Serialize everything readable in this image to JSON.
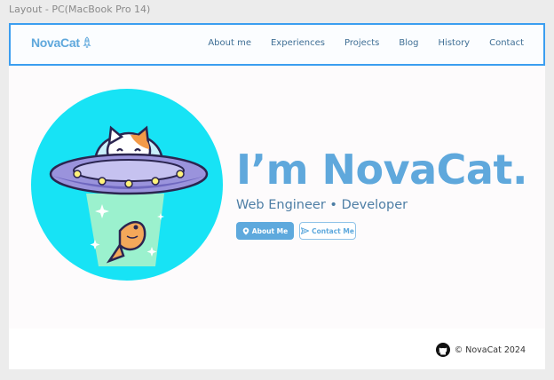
{
  "frame_label": "Layout - PC(MacBook Pro 14)",
  "header": {
    "brand": "NovaCat",
    "nav": [
      "About me",
      "Experiences",
      "Projects",
      "Blog",
      "History",
      "Contact"
    ]
  },
  "hero": {
    "title": "I’m NovaCat.",
    "subtitle": "Web Engineer • Developer",
    "primary_button": "About Me",
    "secondary_button": "Contact Me",
    "illustration": "cat-ufo-illustration"
  },
  "footer": {
    "copyright": "© NovaCat 2024",
    "icon": "github-icon"
  },
  "colors": {
    "accent": "#5fa8dc",
    "nav_text": "#3f6f95",
    "selection": "#3b9ef0",
    "circle": "#17e3f5"
  }
}
